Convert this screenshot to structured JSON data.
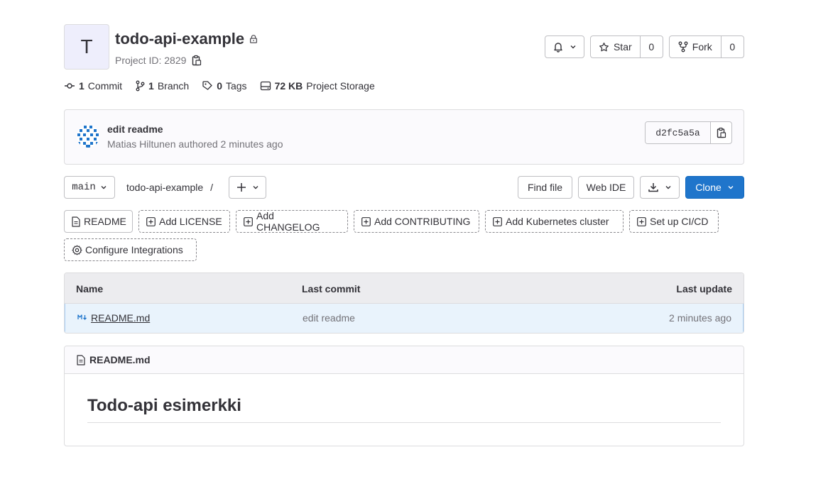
{
  "project": {
    "avatar_letter": "T",
    "name": "todo-api-example",
    "id_label": "Project ID: 2829"
  },
  "actions": {
    "star_label": "Star",
    "star_count": "0",
    "fork_label": "Fork",
    "fork_count": "0"
  },
  "stats": {
    "commits_count": "1",
    "commits_label": "Commit",
    "branches_count": "1",
    "branches_label": "Branch",
    "tags_count": "0",
    "tags_label": "Tags",
    "storage_size": "72 KB",
    "storage_label": "Project Storage"
  },
  "last_commit": {
    "title": "edit readme",
    "author_line": "Matias Hiltunen authored 2 minutes ago",
    "sha": "d2fc5a5a"
  },
  "toolbar": {
    "branch": "main",
    "breadcrumb": "todo-api-example",
    "breadcrumb_sep": "/",
    "find_file": "Find file",
    "web_ide": "Web IDE",
    "clone": "Clone"
  },
  "quick_actions": [
    "README",
    "Add LICENSE",
    "Add CHANGELOG",
    "Add CONTRIBUTING",
    "Add Kubernetes cluster",
    "Set up CI/CD",
    "Configure Integrations"
  ],
  "table": {
    "headers": {
      "name": "Name",
      "last_commit": "Last commit",
      "last_update": "Last update"
    },
    "rows": [
      {
        "name": "README.md",
        "commit": "edit readme",
        "updated": "2 minutes ago"
      }
    ]
  },
  "readme": {
    "filename": "README.md",
    "heading": "Todo-api esimerkki"
  },
  "colors": {
    "primary": "#1f75cb",
    "row_highlight": "#e9f3fc",
    "muted_text": "#737278"
  }
}
